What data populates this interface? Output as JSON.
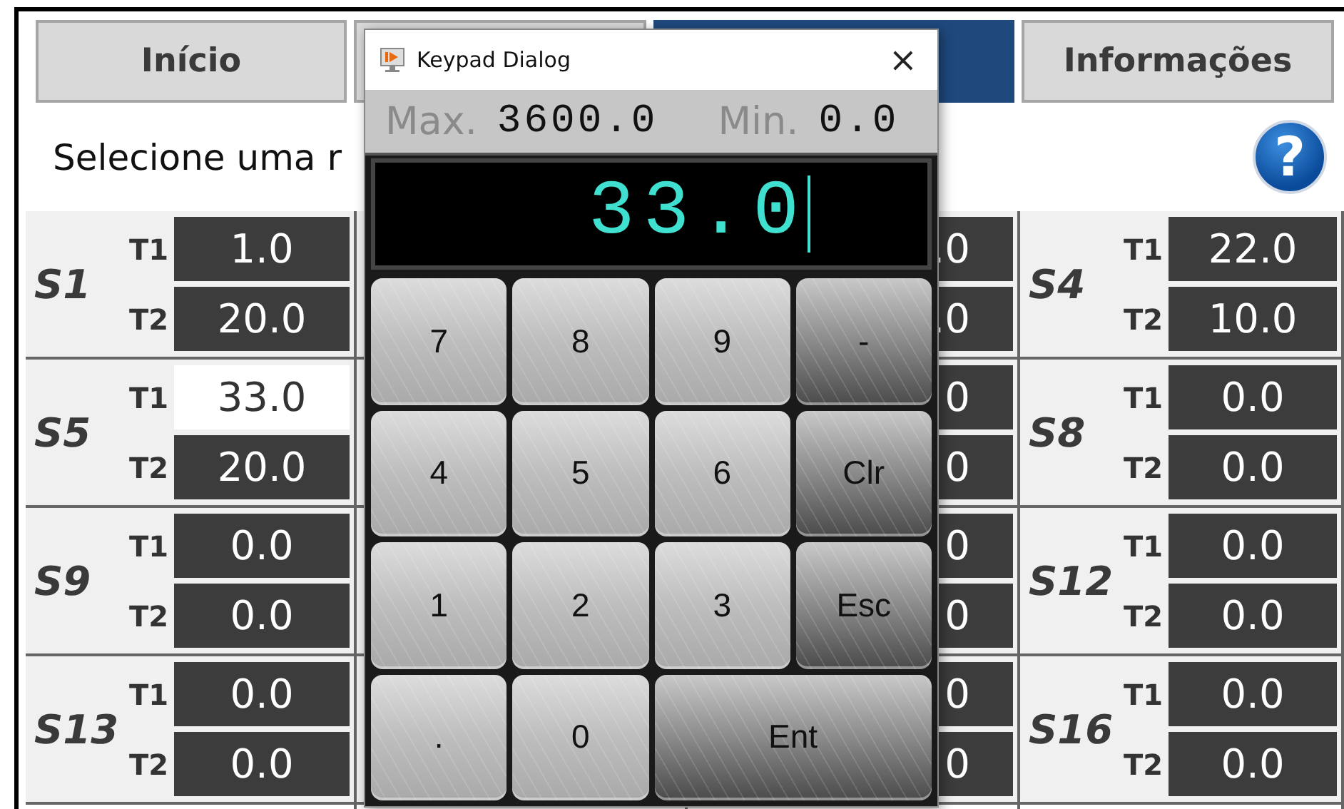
{
  "tabs": [
    {
      "label": "Início",
      "selected": false
    },
    {
      "selected": false
    },
    {
      "selected": true
    },
    {
      "label": "Informações",
      "selected": false
    }
  ],
  "prompt": "Selecione uma r",
  "help_button": {
    "glyph": "?"
  },
  "sensors_left": [
    {
      "name": "S1",
      "readings": [
        {
          "label": "T1",
          "value": "1.0",
          "selected": false
        },
        {
          "label": "T2",
          "value": "20.0",
          "selected": false
        }
      ]
    },
    {
      "name": "S5",
      "readings": [
        {
          "label": "T1",
          "value": "33.0",
          "selected": true
        },
        {
          "label": "T2",
          "value": "20.0",
          "selected": false
        }
      ]
    },
    {
      "name": "S9",
      "readings": [
        {
          "label": "T1",
          "value": "0.0",
          "selected": false
        },
        {
          "label": "T2",
          "value": "0.0",
          "selected": false
        }
      ]
    },
    {
      "name": "S13",
      "readings": [
        {
          "label": "T1",
          "value": "0.0",
          "selected": false
        },
        {
          "label": "T2",
          "value": "0.0",
          "selected": false
        }
      ]
    }
  ],
  "sensors_partial": [
    {
      "readings": [
        {
          "value": ".0"
        },
        {
          "value": ".0"
        }
      ]
    },
    {
      "readings": [
        {
          "value": "0"
        },
        {
          "value": "0"
        }
      ]
    },
    {
      "readings": [
        {
          "value": "0"
        },
        {
          "value": "0"
        }
      ]
    },
    {
      "readings": [
        {
          "value": "0"
        },
        {
          "value": "0"
        }
      ]
    }
  ],
  "sensors_right": [
    {
      "name": "S4",
      "readings": [
        {
          "label": "T1",
          "value": "22.0",
          "selected": false
        },
        {
          "label": "T2",
          "value": "10.0",
          "selected": false
        }
      ]
    },
    {
      "name": "S8",
      "readings": [
        {
          "label": "T1",
          "value": "0.0",
          "selected": false
        },
        {
          "label": "T2",
          "value": "0.0",
          "selected": false
        }
      ]
    },
    {
      "name": "S12",
      "readings": [
        {
          "label": "T1",
          "value": "0.0",
          "selected": false
        },
        {
          "label": "T2",
          "value": "0.0",
          "selected": false
        }
      ]
    },
    {
      "name": "S16",
      "readings": [
        {
          "label": "T1",
          "value": "0.0",
          "selected": false
        },
        {
          "label": "T2",
          "value": "0.0",
          "selected": false
        }
      ]
    }
  ],
  "dialog": {
    "title": "Keypad Dialog",
    "close": "×",
    "limits": [
      {
        "label": "Max.",
        "value": "3600.0"
      },
      {
        "label": "Min.",
        "value": "0.0"
      }
    ],
    "display": "33.0",
    "keys": [
      {
        "label": "7",
        "kind": "digit"
      },
      {
        "label": "8",
        "kind": "digit"
      },
      {
        "label": "9",
        "kind": "digit"
      },
      {
        "label": "-",
        "kind": "function"
      },
      {
        "label": "4",
        "kind": "digit"
      },
      {
        "label": "5",
        "kind": "digit"
      },
      {
        "label": "6",
        "kind": "digit"
      },
      {
        "label": "Clr",
        "kind": "function"
      },
      {
        "label": "1",
        "kind": "digit"
      },
      {
        "label": "2",
        "kind": "digit"
      },
      {
        "label": "3",
        "kind": "digit"
      },
      {
        "label": "Esc",
        "kind": "function"
      },
      {
        "label": ".",
        "kind": "digit"
      },
      {
        "label": "0",
        "kind": "digit"
      },
      {
        "label": "Ent",
        "kind": "enter"
      }
    ]
  }
}
